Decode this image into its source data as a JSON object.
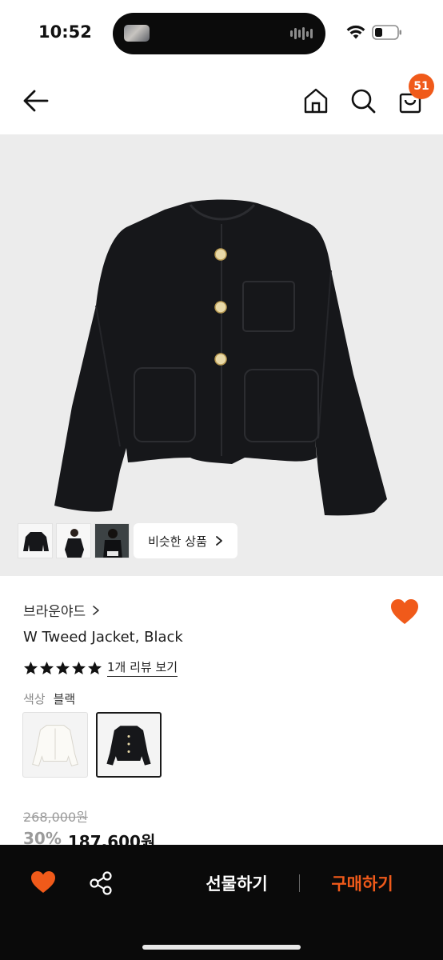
{
  "status_bar": {
    "time": "10:52"
  },
  "header": {
    "cart_count": "51"
  },
  "gallery": {
    "similar_label": "비슷한 상품",
    "thumbnails": [
      "jacket-black-flat",
      "model-front",
      "model-seated"
    ]
  },
  "product": {
    "brand": "브라운야드",
    "name": "W Tweed Jacket, Black",
    "rating_stars": 5,
    "review_link": "1개 리뷰 보기",
    "color_label": "색상",
    "color_value": "블랙",
    "swatches": [
      {
        "name": "ivory",
        "selected": false
      },
      {
        "name": "black",
        "selected": true
      }
    ],
    "original_price": "268,000원",
    "discount": "30%",
    "sale_price": "187,600원"
  },
  "bottom_bar": {
    "gift_label": "선물하기",
    "buy_label": "구매하기"
  },
  "colors": {
    "accent": "#f05a1a",
    "jacket": "#16171a",
    "image_bg": "#ececec"
  }
}
